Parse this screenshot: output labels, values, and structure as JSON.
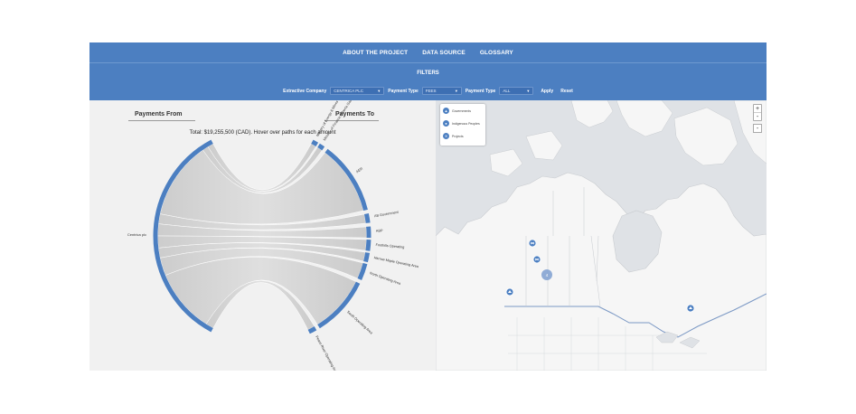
{
  "nav": {
    "items": [
      "ABOUT THE PROJECT",
      "DATA SOURCE",
      "GLOSSARY"
    ]
  },
  "filters": {
    "title": "FILTERS",
    "company_label": "Extractive Company",
    "company_value": "CENTRICA PLC",
    "payment_type_label": "Payment Type",
    "payment_type_value": "FEES",
    "payment_type2_label": "Payment Type",
    "payment_type2_value": "ALL",
    "apply_label": "Apply",
    "reset_label": "Reset"
  },
  "chord": {
    "from_heading": "Payments From",
    "to_heading": "Payments To",
    "total_text": "Total: $19,255,500 (CAD). Hover over paths for each amount",
    "source_label": "Centrica plc",
    "targets": [
      "Ministry of Energy & Mines",
      "Ministry of Finance, Alberta Gas and Gas Resources Branch",
      "AER",
      "AB Government",
      "ABP",
      "Foothills Operating",
      "Harrow Maple Operating Area",
      "North Operating Area",
      "South Operating Area",
      "Peace River Operating Area"
    ],
    "colors": {
      "arc": "#4c7fc1",
      "ribbon": "#c9c9c9"
    }
  },
  "map": {
    "legend": [
      {
        "label": "Governments",
        "icon": "building-icon"
      },
      {
        "label": "Indigenous Peoples",
        "icon": "people-icon"
      },
      {
        "label": "Projects",
        "icon": "tools-icon"
      }
    ],
    "zoom_in": "+",
    "zoom_out": "-",
    "collapse": "-",
    "cluster_count": "4"
  }
}
